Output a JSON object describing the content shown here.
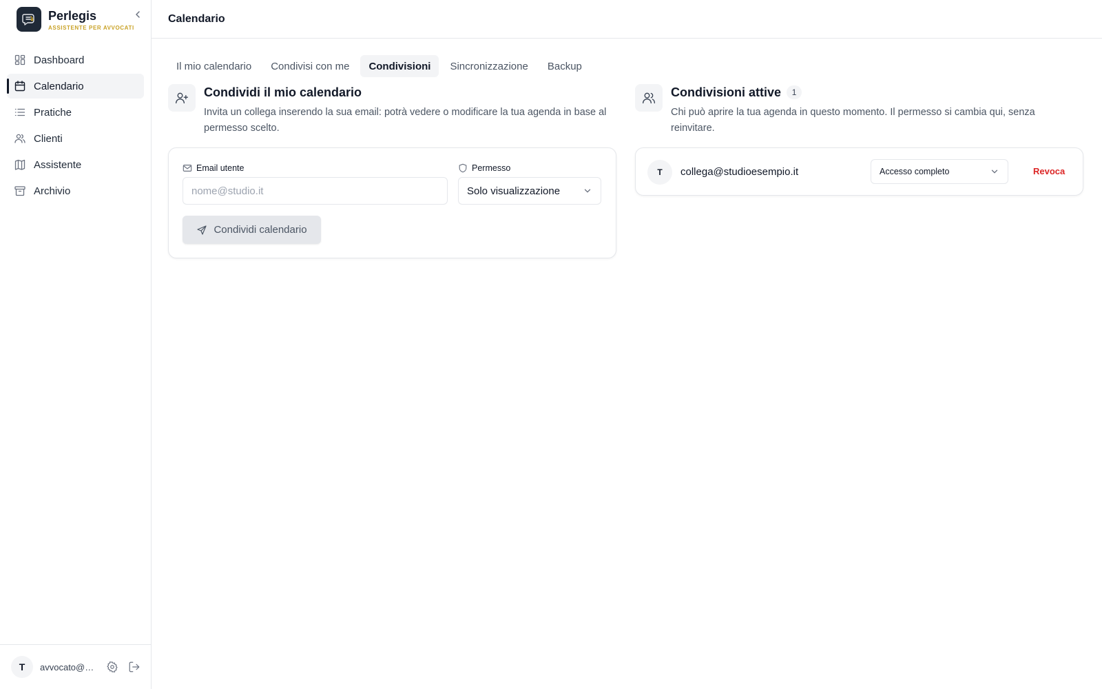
{
  "app": {
    "name": "Perlegis",
    "tagline": "ASSISTENTE PER AVVOCATI"
  },
  "sidebar": {
    "items": [
      {
        "label": "Dashboard",
        "icon": "dashboard-icon",
        "active": false
      },
      {
        "label": "Calendario",
        "icon": "calendar-icon",
        "active": true
      },
      {
        "label": "Pratiche",
        "icon": "list-icon",
        "active": false
      },
      {
        "label": "Clienti",
        "icon": "users-icon",
        "active": false
      },
      {
        "label": "Assistente",
        "icon": "book-icon",
        "active": false
      },
      {
        "label": "Archivio",
        "icon": "archive-icon",
        "active": false
      }
    ],
    "footer": {
      "avatar_initial": "T",
      "email": "avvocato@studio.it"
    }
  },
  "header": {
    "title": "Calendario"
  },
  "tabs": [
    {
      "label": "Il mio calendario",
      "active": false
    },
    {
      "label": "Condivisi con me",
      "active": false
    },
    {
      "label": "Condivisioni",
      "active": true
    },
    {
      "label": "Sincronizzazione",
      "active": false
    },
    {
      "label": "Backup",
      "active": false
    }
  ],
  "share_section": {
    "title": "Condividi il mio calendario",
    "description": "Invita un collega inserendo la sua email: potrà vedere o modificare la tua agenda in base al permesso scelto.",
    "email_label": "Email utente",
    "email_placeholder": "nome@studio.it",
    "email_value": "",
    "permission_label": "Permesso",
    "permission_value": "Solo visualizzazione",
    "submit_label": "Condividi calendario"
  },
  "active_section": {
    "title": "Condivisioni attive",
    "count": "1",
    "description": "Chi può aprire la tua agenda in questo momento. Il permesso si cambia qui, senza reinvitare.",
    "shares": [
      {
        "avatar_initial": "T",
        "email": "collega@studioesempio.it",
        "permission": "Accesso completo",
        "revoke_label": "Revoca"
      }
    ]
  },
  "colors": {
    "accent": "#111827",
    "tagline": "#c9a227",
    "danger": "#dc2626",
    "muted_bg": "#f3f4f6",
    "border": "#e5e7eb"
  }
}
